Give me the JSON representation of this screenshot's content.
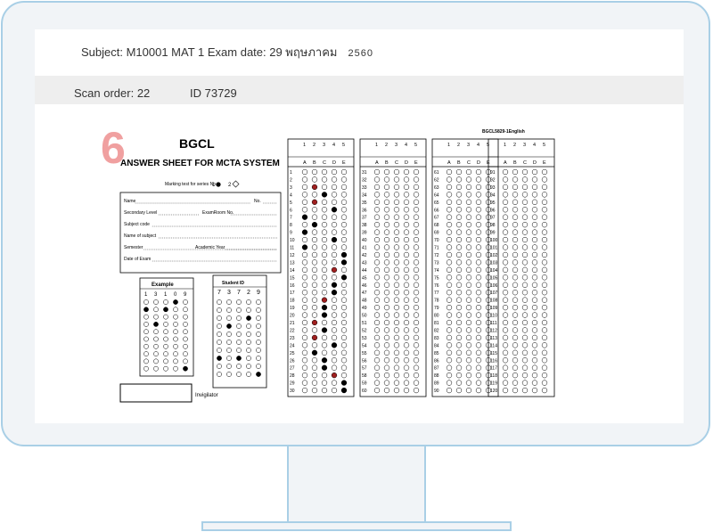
{
  "header": {
    "subject_line": "Subject: M10001  MAT 1 Exam date: 29 พฤษภาคม",
    "year": "2560"
  },
  "scan": {
    "order_label": "Scan order: 22",
    "id_label": "ID 73729"
  },
  "sheet": {
    "scan_number": "6",
    "brand": "BGCL",
    "title": "ANSWER SHEET FOR MCTA SYSTEM",
    "series_note": "Marking test for series No.",
    "series_1": "1",
    "series_2": "2",
    "form_fields": [
      "Name",
      "No.",
      "Secondary Level",
      "ExamRoom No.",
      "Subject code",
      "Name of subject",
      "Semester",
      "Academic Year",
      "Date of Exam"
    ],
    "example_label": "Example",
    "example_digits": [
      "1",
      "3",
      "1",
      "0",
      "9"
    ],
    "student_id_label": "Student ID",
    "student_id_digits": [
      "7",
      "3",
      "7",
      "2",
      "9"
    ],
    "invigilator_label": "Invigilator",
    "top_code": "BGCL5829-1English",
    "choice_numbers": [
      "1",
      "2",
      "3",
      "4",
      "5"
    ],
    "choice_letters": [
      "A",
      "B",
      "C",
      "D",
      "E"
    ]
  }
}
